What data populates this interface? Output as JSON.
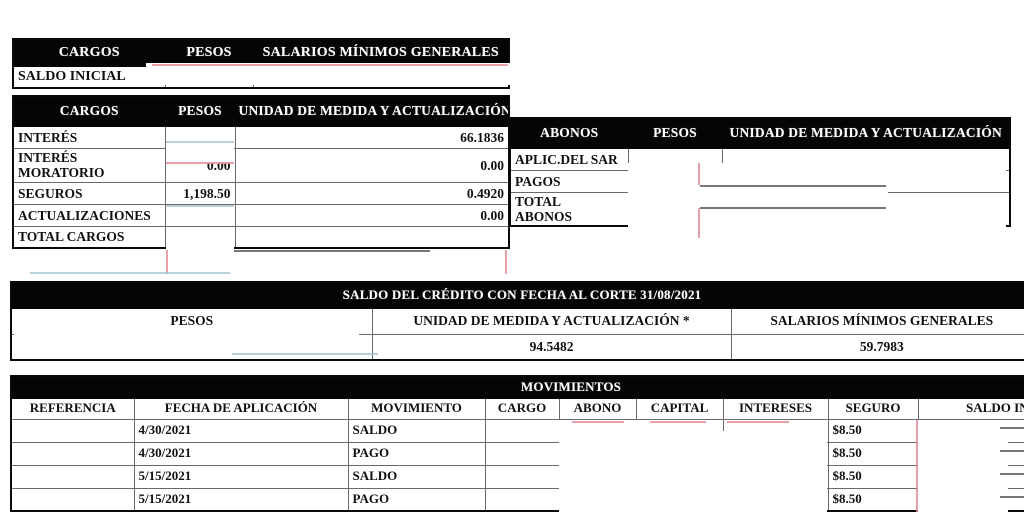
{
  "document": {
    "type": "credit-statement",
    "language": "es-MX"
  },
  "saldo_inicial_table": {
    "headers": [
      "CARGOS",
      "PESOS",
      "SALARIOS MÍNIMOS GENERALES"
    ],
    "rows": [
      {
        "label": "SALDO INICIAL",
        "pesos": "",
        "smg": ""
      }
    ]
  },
  "cargos_table": {
    "headers": [
      "CARGOS",
      "PESOS",
      "UNIDAD DE MEDIDA Y ACTUALIZACIÓN"
    ],
    "rows": [
      {
        "label": "INTERÉS",
        "pesos": "",
        "uma": "66.1836"
      },
      {
        "label": "INTERÉS MORATORIO",
        "label_line1": "INTERÉS",
        "label_line2": "MORATORIO",
        "pesos": "0.00",
        "uma": "0.00"
      },
      {
        "label": "SEGUROS",
        "pesos": "1,198.50",
        "uma": "0.4920"
      },
      {
        "label": "ACTUALIZACIONES",
        "pesos": "",
        "uma": "0.00"
      },
      {
        "label": "TOTAL CARGOS",
        "pesos": "",
        "uma": ""
      }
    ]
  },
  "abonos_table": {
    "headers": [
      "ABONOS",
      "PESOS",
      "UNIDAD DE MEDIDA Y ACTUALIZACIÓN"
    ],
    "rows": [
      {
        "label": "APLIC.DEL SAR",
        "pesos": "",
        "uma": ""
      },
      {
        "label": "PAGOS",
        "pesos": "",
        "uma": ""
      },
      {
        "label": "TOTAL ABONOS",
        "label_line1": "TOTAL",
        "label_line2": "ABONOS",
        "pesos": "",
        "uma": ""
      }
    ]
  },
  "saldo_credito_table": {
    "title": "SALDO DEL CRÉDITO CON FECHA AL CORTE 31/08/2021",
    "fecha_corte": "31/08/2021",
    "headers": [
      "PESOS",
      "UNIDAD DE MEDIDA Y ACTUALIZACIÓN *",
      "SALARIOS MÍNIMOS GENERALES"
    ],
    "values": [
      "",
      "94.5482",
      "59.7983"
    ]
  },
  "movimientos_table": {
    "title": "MOVIMIENTOS",
    "headers": [
      "REFERENCIA",
      "FECHA DE APLICACIÓN",
      "MOVIMIENTO",
      "CARGO",
      "ABONO",
      "CAPITAL",
      "INTERESES",
      "SEGURO",
      "SALDO INSOLUTO"
    ],
    "rows": [
      {
        "referencia": "",
        "fecha": "4/30/2021",
        "movimiento": "SALDO",
        "cargo": "",
        "abono": "",
        "capital": "",
        "intereses": "",
        "seguro": "$8.50",
        "saldo_insoluto": ""
      },
      {
        "referencia": "",
        "fecha": "4/30/2021",
        "movimiento": "PAGO",
        "cargo": "",
        "abono": "",
        "capital": "",
        "intereses": "",
        "seguro": "$8.50",
        "saldo_insoluto": ""
      },
      {
        "referencia": "",
        "fecha": "5/15/2021",
        "movimiento": "SALDO",
        "cargo": "",
        "abono": "",
        "capital": "",
        "intereses": "",
        "seguro": "$8.50",
        "saldo_insoluto": ""
      },
      {
        "referencia": "",
        "fecha": "5/15/2021",
        "movimiento": "PAGO",
        "cargo": "",
        "abono": "",
        "capital": "",
        "intereses": "",
        "seguro": "$8.50",
        "saldo_insoluto": ""
      }
    ]
  },
  "colors": {
    "header_bg": "#050505",
    "header_text": "#ffffff",
    "grid": "#6a6a6a",
    "outer_border": "#0a0a0a",
    "scan_red": "#e8909a",
    "scan_teal": "#9fc4cc",
    "paper": "#ffffff"
  }
}
